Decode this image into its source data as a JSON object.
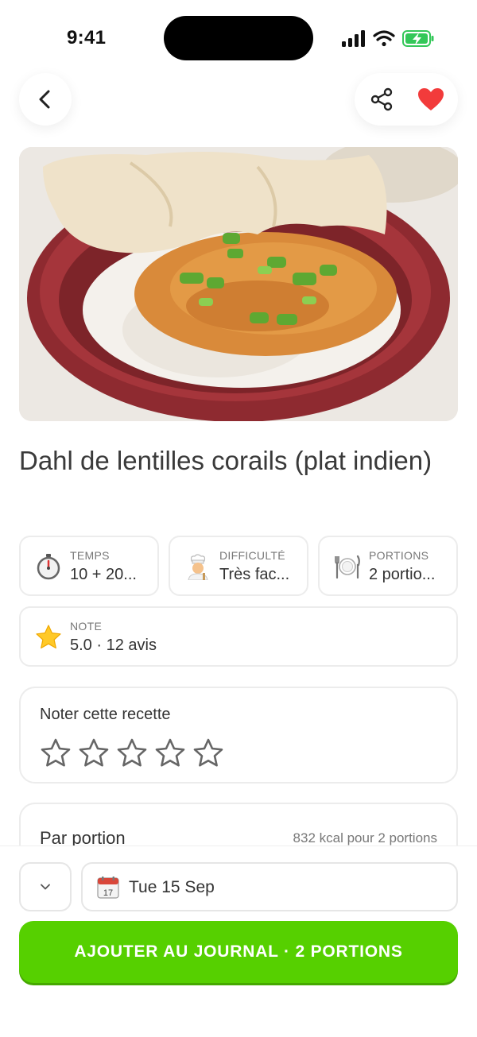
{
  "status_bar": {
    "time": "9:41",
    "icons": [
      "signal-icon",
      "wifi-icon",
      "battery-charging-icon"
    ]
  },
  "header": {
    "back_icon": "chevron-left-icon",
    "share_icon": "share-icon",
    "favorite_icon": "heart-icon",
    "favorite_color": "#f23b3b"
  },
  "recipe": {
    "title": "Dahl de lentilles corails (plat indien)",
    "info": [
      {
        "icon": "stopwatch-icon",
        "label": "TEMPS",
        "value": "10 + 20..."
      },
      {
        "icon": "cook-icon",
        "label": "DIFFICULTÉ",
        "value": "Très fac..."
      },
      {
        "icon": "plate-cutlery-icon",
        "label": "PORTIONS",
        "value": "2 portio..."
      }
    ],
    "note": {
      "icon": "star-icon",
      "label": "NOTE",
      "value": "5.0 · 12 avis"
    }
  },
  "rating": {
    "title": "Noter cette recette",
    "stars_total": 5,
    "stars_selected": 0
  },
  "per_portion": {
    "title": "Par portion",
    "kcal_text": "832 kcal pour 2 portions"
  },
  "bottom": {
    "dropdown_icon": "chevron-down-icon",
    "date_icon": "calendar-icon",
    "calendar_day": "17",
    "date": "Tue 15 Sep",
    "add_button": "AJOUTER AU JOURNAL · 2 PORTIONS",
    "accent_color": "#56d000"
  }
}
